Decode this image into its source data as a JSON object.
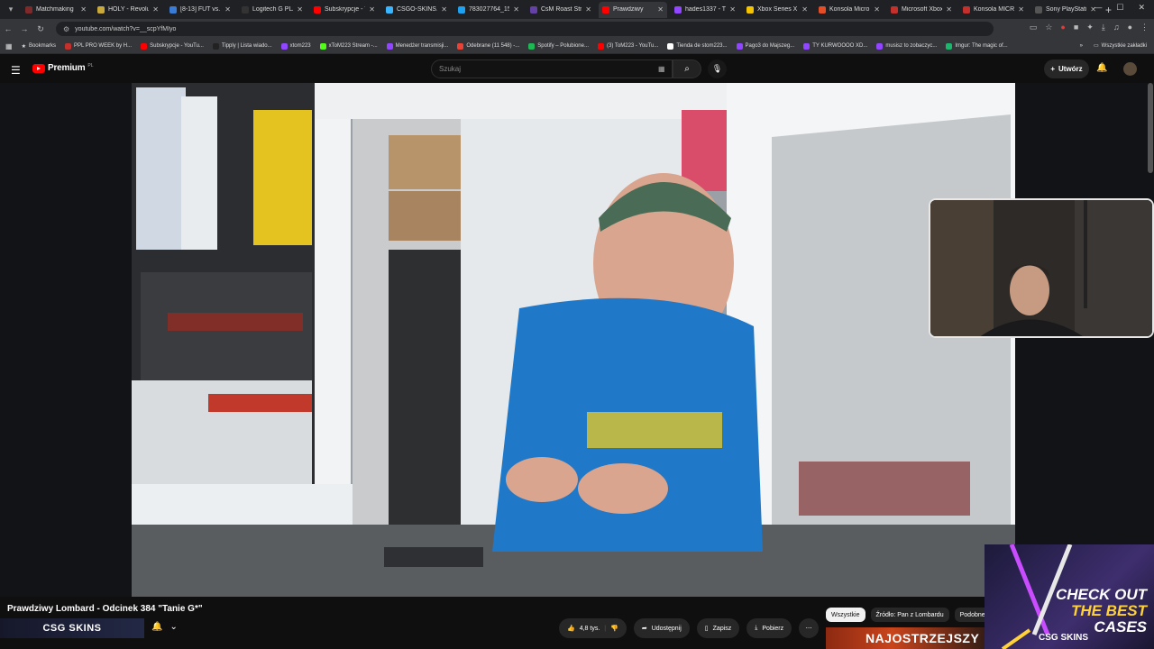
{
  "browser": {
    "tabs": [
      {
        "label": "Matchmaking",
        "color": "#7f2a2a"
      },
      {
        "label": "HOLY - Revolu",
        "color": "#c9a93a"
      },
      {
        "label": "[8-13] FUT vs. V",
        "color": "#3a7bd5"
      },
      {
        "label": "Logitech G PLA",
        "color": "#333333"
      },
      {
        "label": "Subskrypcje - Y",
        "color": "#ff0000"
      },
      {
        "label": "CSGO-SKINS.C",
        "color": "#39b6ff"
      },
      {
        "label": "783027764_15",
        "color": "#1da1f2"
      },
      {
        "label": "CsM Roast Stre",
        "color": "#6441a5"
      },
      {
        "label": "Prawdziwy",
        "color": "#ff0000",
        "active": true
      },
      {
        "label": "hades1337 - T",
        "color": "#9146ff"
      },
      {
        "label": "Xbox Series X",
        "color": "#f5c400"
      },
      {
        "label": "Konsola Micro",
        "color": "#e44d26"
      },
      {
        "label": "Microsoft Xbox",
        "color": "#c4302b"
      },
      {
        "label": "Konsola MICRO",
        "color": "#c4302b"
      },
      {
        "label": "Sony PlayStatio",
        "color": "#555555"
      }
    ],
    "url": "youtube.com/watch?v=__scpYfMIyo",
    "bookmarks_label": "Bookmarks",
    "bookmarks": [
      {
        "label": "PPL PRO WEEK by H...",
        "color": "#c4302b"
      },
      {
        "label": "Subskrypcje - YouTu...",
        "color": "#ff0000"
      },
      {
        "label": "Tipply | Lista wiado...",
        "color": "#222222"
      },
      {
        "label": "xtom223",
        "color": "#9146ff"
      },
      {
        "label": "xToM223 Stream -...",
        "color": "#53fc18"
      },
      {
        "label": "Menedżer transmisji...",
        "color": "#9146ff"
      },
      {
        "label": "Odebrane (11 548) -...",
        "color": "#ea4335"
      },
      {
        "label": "Spotify – Polubione...",
        "color": "#1db954"
      },
      {
        "label": "(3) ToM223 - YouTu...",
        "color": "#ff0000"
      },
      {
        "label": "Tienda de stom223...",
        "color": "#ffffff"
      },
      {
        "label": "Pago3 do Majszeg...",
        "color": "#9146ff"
      },
      {
        "label": "TY KURWOOOO XD...",
        "color": "#9146ff"
      },
      {
        "label": "musisz to zobaczyc...",
        "color": "#9146ff"
      },
      {
        "label": "Imgur: The magic of...",
        "color": "#1bb76e"
      }
    ],
    "all_bookmarks": "Wszystkie zakładki"
  },
  "youtube": {
    "logo_text": "Premium",
    "logo_sup": "PL",
    "search_placeholder": "Szukaj",
    "create_label": "Utwórz"
  },
  "video": {
    "title": "Prawdziwy Lombard - Odcinek 384 \"Tanie G*\"",
    "channel_banner": "CSG SKINS",
    "likes": "4,8 tys.",
    "share_label": "Udostępnij",
    "save_label": "Zapisz",
    "download_label": "Pobierz"
  },
  "chips": [
    "Wszystkie",
    "Źródło: Pan z Lombardu",
    "Podobne"
  ],
  "ad_thumb_text": "NAJOSTRZEJSZY",
  "promo": {
    "line1": "CHECK OUT",
    "line2": "THE BEST",
    "line3": "CASES",
    "logo": "CSG SKINS"
  }
}
